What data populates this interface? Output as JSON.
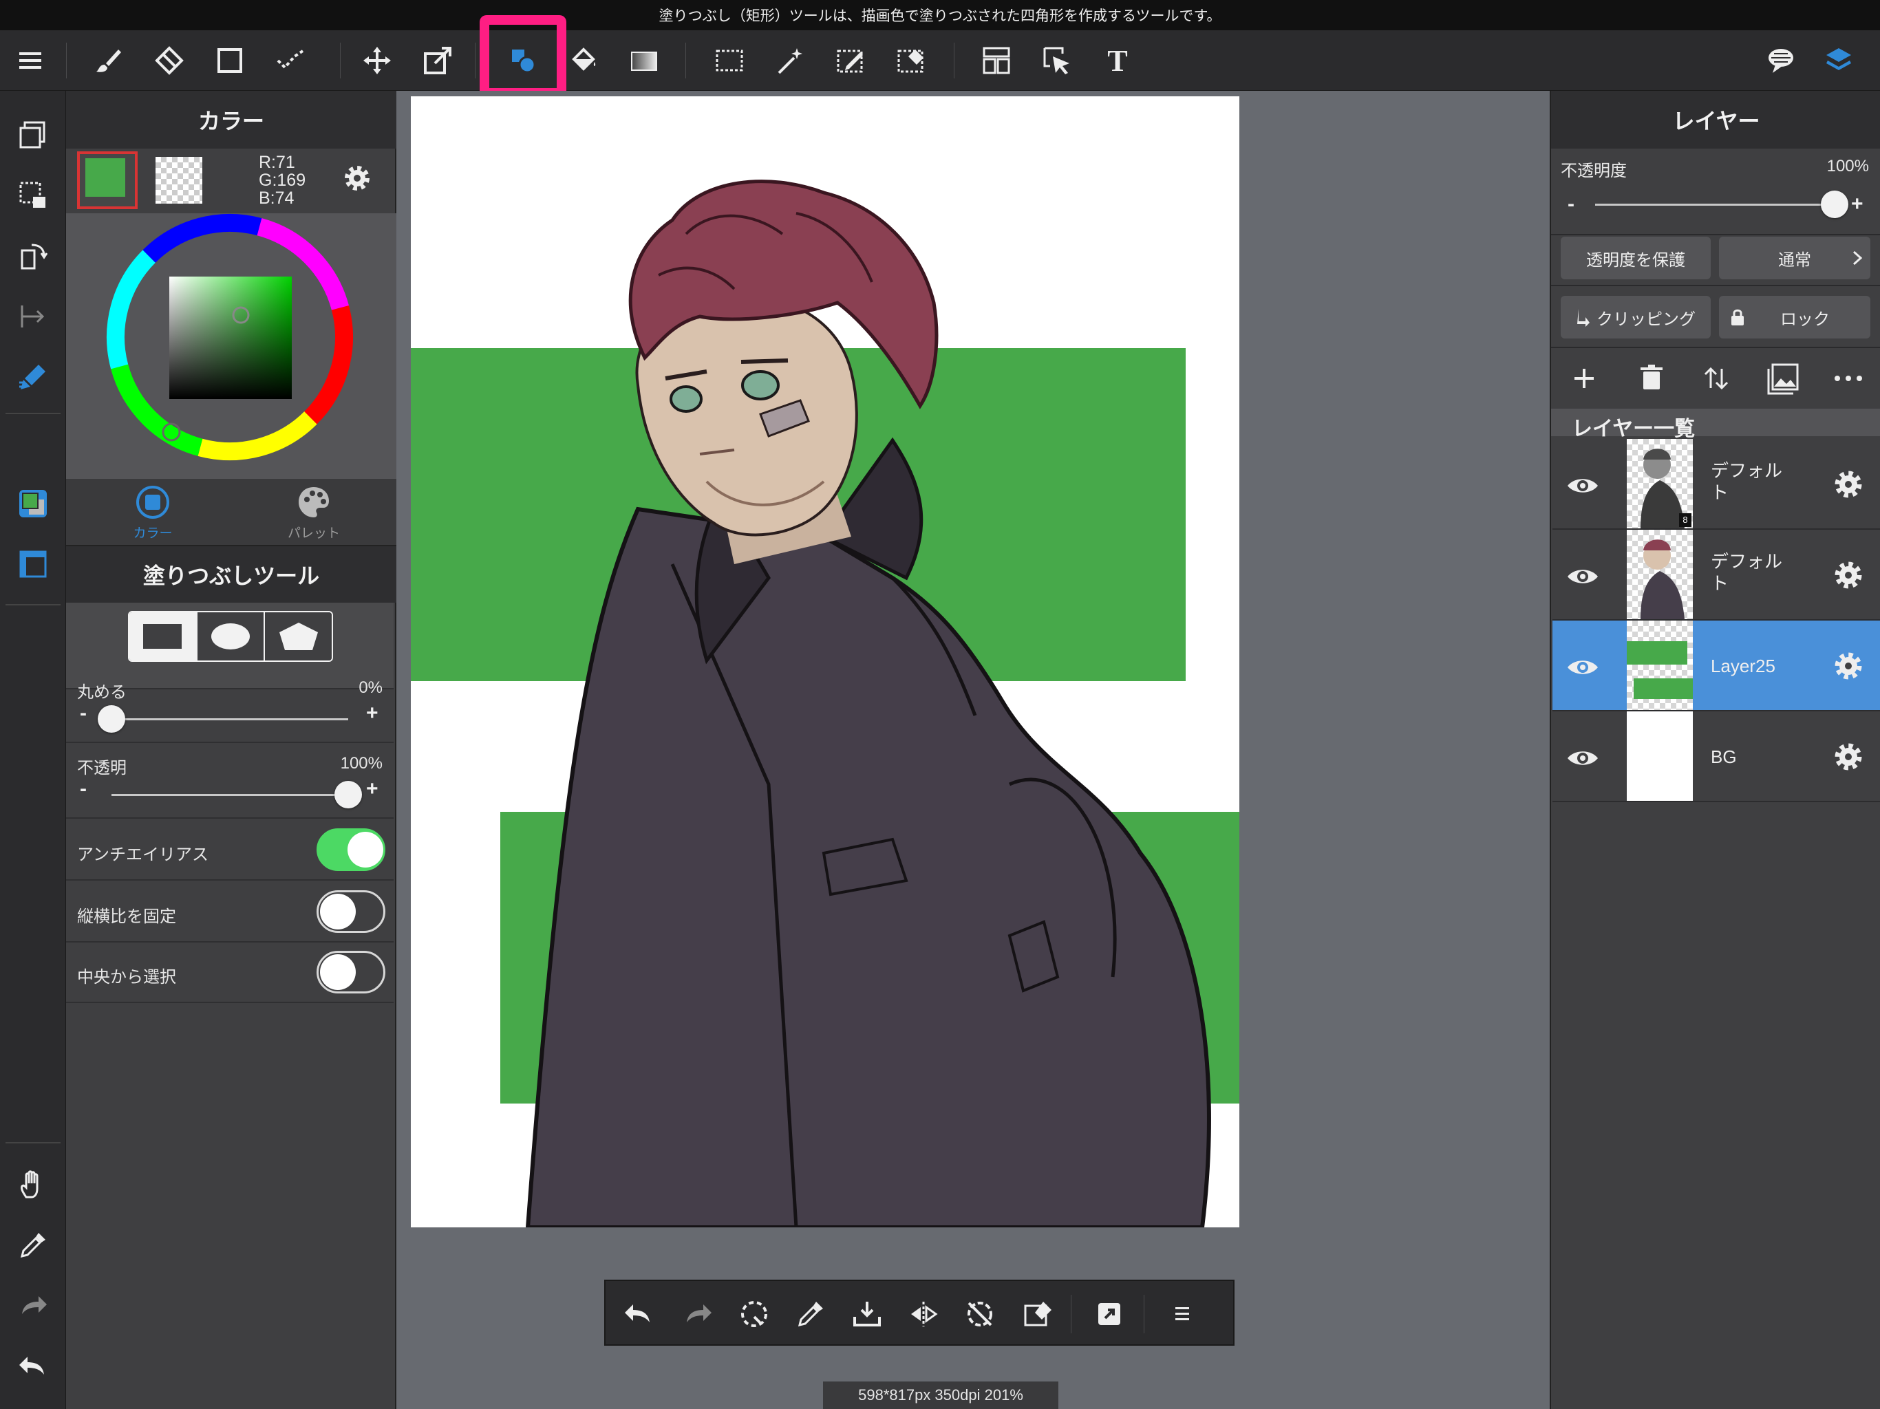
{
  "status_message": "塗りつぶし（矩形）ツールは、描画色で塗りつぶされた四角形を作成するツールです。",
  "toolbar": {
    "tools": [
      "menu-icon",
      "brush-icon",
      "eraser-icon",
      "rect-shape-icon",
      "dots-icon",
      "move-icon",
      "transform-icon",
      "fill-shape-icon",
      "bucket-icon",
      "gradient-icon",
      "select-rect-icon",
      "magic-wand-icon",
      "select-pen-icon",
      "select-eraser-icon",
      "frame-icon",
      "operation-icon",
      "text-icon",
      "speech-icon",
      "layers-icon"
    ],
    "active_tool": "fill-shape-icon",
    "text_tool_glyph": "T"
  },
  "color_panel": {
    "title": "カラー",
    "foreground_color": "#47a94a",
    "r": "R:71",
    "g": "G:169",
    "b": "B:74",
    "tabs": [
      {
        "label": "カラー",
        "active": true
      },
      {
        "label": "パレット",
        "active": false
      }
    ]
  },
  "tool_panel": {
    "title": "塗りつぶしツール",
    "shapes": [
      "rectangle",
      "ellipse",
      "polygon"
    ],
    "active_shape": "rectangle",
    "rounding_label": "丸める",
    "rounding_value": "0%",
    "rounding_fraction": 0.0,
    "opacity_label": "不透明",
    "opacity_value": "100%",
    "opacity_fraction": 1.0,
    "minus": "-",
    "plus": "+",
    "antialias_label": "アンチエイリアス",
    "antialias_on": true,
    "aspect_label": "縦横比を固定",
    "aspect_on": false,
    "center_label": "中央から選択",
    "center_on": false
  },
  "layer_panel": {
    "title": "レイヤー",
    "opacity_label": "不透明度",
    "opacity_value": "100%",
    "opacity_fraction": 1.0,
    "minus": "-",
    "plus": "+",
    "protect_alpha": "透明度を保護",
    "blend_mode": "通常",
    "clipping": "クリッピング",
    "lock": "ロック",
    "list_title": "レイヤー一覧",
    "layers": [
      {
        "name": "デフォルト",
        "badge": "8",
        "selected": false
      },
      {
        "name": "デフォルト",
        "badge": "",
        "selected": false
      },
      {
        "name": "Layer25",
        "badge": "",
        "selected": true
      },
      {
        "name": "BG",
        "badge": "",
        "selected": false
      }
    ]
  },
  "bottom_bar": {
    "tools": [
      "undo-icon",
      "redo-icon",
      "lasso-rotate-icon",
      "eyedropper-icon",
      "import-icon",
      "flip-icon",
      "rotate-reset-icon",
      "clear-icon",
      "share-icon",
      "more-menu-icon"
    ]
  },
  "doc_info": "598*817px 350dpi 201%"
}
